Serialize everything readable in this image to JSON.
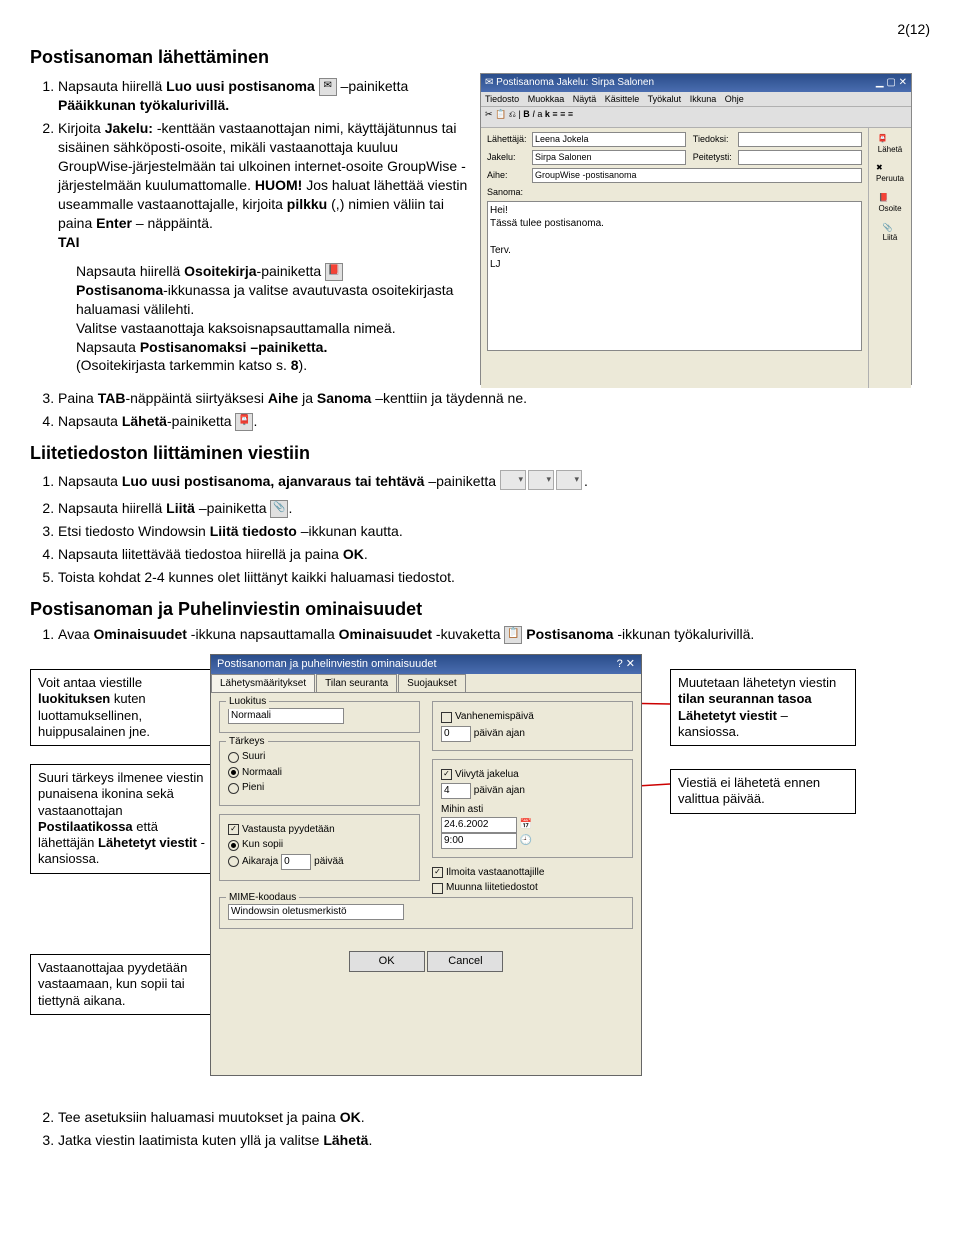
{
  "page_num": "2(12)",
  "h1": "Postisanoman lähettäminen",
  "s1_li1_a": "Napsauta hiirellä ",
  "s1_li1_b": "Luo uusi postisanoma",
  "s1_li1_c": " –painiketta ",
  "s1_li1_d": "Pääikkunan työkalurivillä.",
  "s1_li2_a": "Kirjoita ",
  "s1_li2_b": "Jakelu:",
  "s1_li2_c": " -kenttään vastaanottajan nimi, käyttäjätunnus tai sisäinen sähköposti-osoite, mikäli vastaanottaja kuuluu GroupWise-järjestelmään tai ulkoinen internet-osoite GroupWise -järjestelmään kuulumattomalle. ",
  "s1_li2_d": "HUOM!",
  "s1_li2_e": " Jos haluat lähettää viestin useammalle vastaanottajalle, kirjoita ",
  "s1_li2_f": "pilkku",
  "s1_li2_g": " (,) nimien väliin tai paina ",
  "s1_li2_h": "Enter",
  "s1_li2_i": " – näppäintä.",
  "s1_tai": "TAI",
  "s1_sub_a": "Napsauta hiirellä ",
  "s1_sub_b": "Osoitekirja",
  "s1_sub_c": "-painiketta ",
  "s1_sub_d": "Postisanoma",
  "s1_sub_e": "-ikkunassa ja valitse avautuvasta osoitekirjasta haluamasi välilehti.",
  "s1_sub_f": "Valitse vastaanottaja kaksoisnapsauttamalla nimeä.",
  "s1_sub_g": "Napsauta ",
  "s1_sub_h": "Postisanomaksi –painiketta.",
  "s1_sub_i": "(Osoitekirjasta tarkemmin katso s. ",
  "s1_sub_j": "8",
  "s1_sub_k": ").",
  "s1_li3_a": "Paina ",
  "s1_li3_b": "TAB",
  "s1_li3_c": "-näppäintä siirtyäksesi ",
  "s1_li3_d": "Aihe",
  "s1_li3_e": " ja ",
  "s1_li3_f": "Sanoma",
  "s1_li3_g": " –kenttiin ja täydennä ne.",
  "s1_li4_a": "Napsauta ",
  "s1_li4_b": "Lähetä",
  "s1_li4_c": "-painiketta ",
  "h2": "Liitetiedoston liittäminen viestiin",
  "s2_li1_a": "Napsauta ",
  "s2_li1_b": "Luo uusi postisanoma, ajanvaraus tai tehtävä",
  "s2_li1_c": " –painiketta ",
  "s2_li2_a": "Napsauta hiirellä ",
  "s2_li2_b": "Liitä",
  "s2_li2_c": " –painiketta ",
  "s2_li3_a": "Etsi tiedosto Windowsin ",
  "s2_li3_b": "Liitä tiedosto",
  "s2_li3_c": " –ikkunan kautta.",
  "s2_li4_a": "Napsauta liitettävää tiedostoa hiirellä ja paina ",
  "s2_li4_b": "OK",
  "s2_li5": "Toista kohdat 2-4 kunnes olet liittänyt kaikki haluamasi tiedostot.",
  "h3": "Postisanoman ja Puhelinviestin ominaisuudet",
  "s3_li1_a": "Avaa ",
  "s3_li1_b": "Ominaisuudet",
  "s3_li1_c": " -ikkuna napsauttamalla ",
  "s3_li1_d": "Ominaisuudet",
  "s3_li1_e": " -kuvaketta ",
  "s3_li1_f": "Postisanoma",
  "s3_li1_g": " -ikkunan työkalurivillä.",
  "callout1_a": "Voit antaa viestille ",
  "callout1_b": "luokituksen",
  "callout1_c": " kuten luottamuksellinen, huippusalainen jne.",
  "callout2_a": "Suuri tärkeys ilmenee viestin punaisena ikonina sekä vastaanottajan ",
  "callout2_b": "Postilaatikossa",
  "callout2_c": " että lähettäjän ",
  "callout2_d": "Lähetetyt viestit",
  "callout2_e": " -kansiossa.",
  "callout3": "Vastaanottajaa pyydetään vastaamaan, kun sopii tai tiettynä aikana.",
  "callout4_a": "Muutetaan lähetetyn viestin ",
  "callout4_b": "tilan seurannan tasoa",
  "callout4_c": " ",
  "callout4_d": "Lähetetyt viestit",
  "callout4_e": " – kansiossa.",
  "callout5": "Viestiä ei lähetetä ennen valittua päivää.",
  "s3_li2_a": "Tee asetuksiin haluamasi muutokset ja paina ",
  "s3_li2_b": "OK",
  "s3_li3_a": "Jatka viestin laatimista kuten yllä ja valitse ",
  "s3_li3_b": "Lähetä",
  "mail": {
    "title": "Postisanoma Jakelu: Sirpa Salonen",
    "menu": [
      "Tiedosto",
      "Muokkaa",
      "Näytä",
      "Käsittele",
      "Työkalut",
      "Ikkuna",
      "Ohje"
    ],
    "from_lbl": "Lähettäjä:",
    "from": "Leena Jokela",
    "to_lbl": "Jakelu:",
    "to": "Sirpa Salonen",
    "cc_lbl": "Tiedoksi:",
    "bcc_lbl": "Peitetysti:",
    "subj_lbl": "Aihe:",
    "subj": "GroupWise -postisanoma",
    "body_lbl": "Sanoma:",
    "body": "Hei!\nTässä tulee postisanoma.\n\nTerv.\nLJ",
    "side": [
      "Lähetä",
      "Peruuta",
      "Osoite",
      "Liitä"
    ]
  },
  "dialog": {
    "title": "Postisanoman ja puhelinviestin ominaisuudet",
    "tabs": [
      "Lähetysmääritykset",
      "Tilan seuranta",
      "Suojaukset"
    ],
    "luokitus_lbl": "Luokitus",
    "luokitus": "Normaali",
    "tarkeys_lbl": "Tärkeys",
    "tarkeys": [
      "Suuri",
      "Normaali",
      "Pieni"
    ],
    "vast_lbl": "Vastausta pyydetään",
    "vast": [
      "Kun sopii",
      "Aikaraja"
    ],
    "vast_days_lbl": "päivää",
    "vast_days": "0",
    "vanh_lbl": "Vanhenemispäivä",
    "vanh_days": "0",
    "vanh_days_lbl": "päivän ajan",
    "viiv_lbl": "Viivytä jakelua",
    "viiv_days": "4",
    "viiv_days_lbl": "päivän ajan",
    "mihin_lbl": "Mihin asti",
    "mihin_date": "24.6.2002",
    "mihin_time": "9:00",
    "ilm_lbl": "Ilmoita vastaanottajille",
    "muu_lbl": "Muunna liitetiedostot",
    "mime_lbl": "MIME-koodaus",
    "mime": "Windowsin oletusmerkistö",
    "ok": "OK",
    "cancel": "Cancel"
  }
}
